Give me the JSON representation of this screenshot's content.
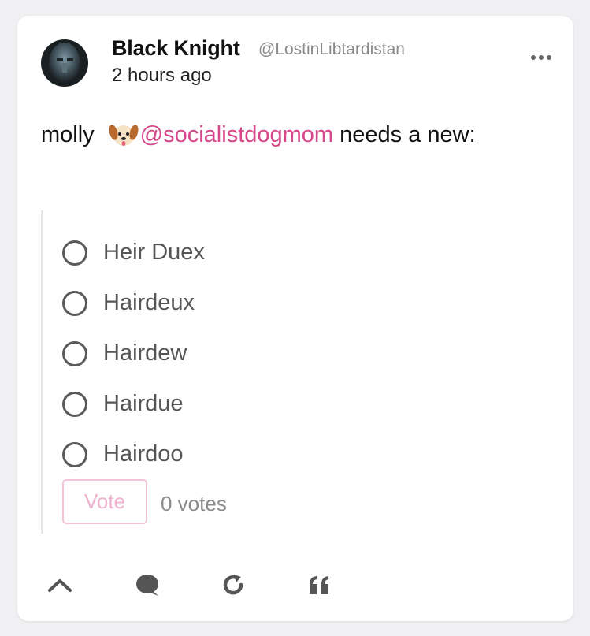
{
  "post": {
    "author": {
      "display_name": "Black Knight",
      "handle": "@LostinLibtardistan"
    },
    "timestamp": "2 hours ago",
    "text_before": "molly ",
    "mention": "@socialistdogmom",
    "text_after": " needs a new:",
    "accent_color": "#d6478b"
  },
  "poll": {
    "options": [
      {
        "label": "Heir Duex"
      },
      {
        "label": "Hairdeux"
      },
      {
        "label": "Hairdew"
      },
      {
        "label": "Hairdue"
      },
      {
        "label": "Hairdoo"
      }
    ],
    "vote_label": "Vote",
    "vote_count": "0 votes"
  },
  "actions": {
    "icons": [
      "upvote-icon",
      "comment-icon",
      "repost-icon",
      "quote-icon"
    ]
  }
}
